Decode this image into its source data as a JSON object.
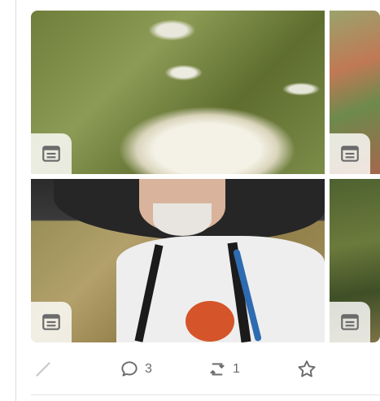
{
  "post": {
    "media": [
      {
        "alt": "flower",
        "icon": "document-icon"
      },
      {
        "alt": "foliage",
        "icon": "document-icon"
      },
      {
        "alt": "hiker",
        "icon": "document-icon"
      },
      {
        "alt": "trees",
        "icon": "document-icon"
      }
    ],
    "actions": {
      "edit_icon": "pencil-icon",
      "reply_count": "3",
      "boost_count": "1",
      "favorite_icon": "star-icon"
    }
  },
  "colors": {
    "icon_gray": "#6b6b6b",
    "badge_bg": "#ffffff",
    "rule": "#dcdcdc"
  }
}
